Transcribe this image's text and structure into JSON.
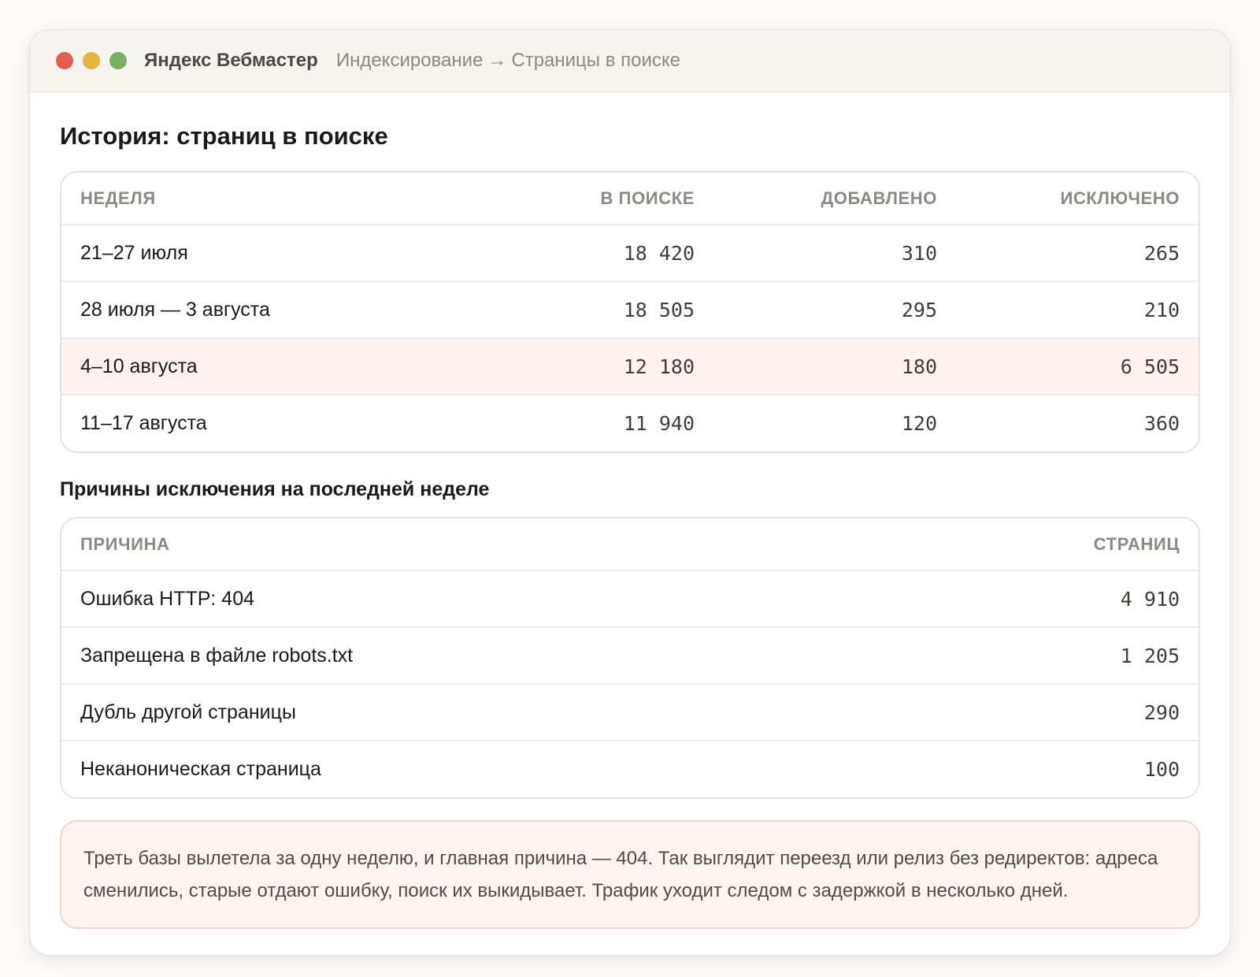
{
  "window": {
    "app_name": "Яндекс Вебмастер",
    "breadcrumb": {
      "section": "Индексирование",
      "separator": "→",
      "page": "Страницы в поиске"
    },
    "controls_colors": {
      "close": "#e25c52",
      "minimize": "#e5b33f",
      "maximize": "#78b15e"
    }
  },
  "history": {
    "title": "История: страниц в поиске",
    "columns": [
      "Неделя",
      "В поиске",
      "Добавлено",
      "Исключено"
    ],
    "rows": [
      {
        "week": "21–27 июля",
        "in_search": "18 420",
        "added": "310",
        "excluded": "265",
        "highlighted": false
      },
      {
        "week": "28 июля — 3 августа",
        "in_search": "18 505",
        "added": "295",
        "excluded": "210",
        "highlighted": false
      },
      {
        "week": "4–10 августа",
        "in_search": "12 180",
        "added": "180",
        "excluded": "6 505",
        "highlighted": true
      },
      {
        "week": "11–17 августа",
        "in_search": "11 940",
        "added": "120",
        "excluded": "360",
        "highlighted": false
      }
    ]
  },
  "reasons": {
    "title": "Причины исключения на последней неделе",
    "columns": [
      "Причина",
      "Страниц"
    ],
    "rows": [
      {
        "reason": "Ошибка HTTP: 404",
        "pages": "4 910"
      },
      {
        "reason": "Запрещена в файле robots.txt",
        "pages": "1 205"
      },
      {
        "reason": "Дубль другой страницы",
        "pages": "290"
      },
      {
        "reason": "Неканоническая страница",
        "pages": "100"
      }
    ]
  },
  "note": {
    "text": "Треть базы вылетела за одну неделю, и главная причина — 404. Так выглядит переезд или релиз без редиректов: адреса сменились, старые отдают ошибку, поиск их выкидывает. Трафик уходит следом с задержкой в несколько дней.",
    "accent_color": "#fdf3f0"
  }
}
